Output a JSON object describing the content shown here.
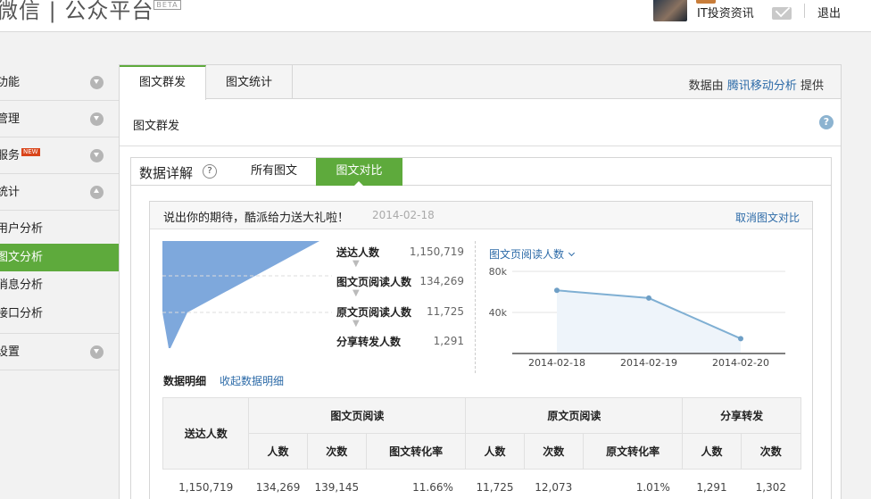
{
  "header": {
    "logo_text": "微信 | 公众平台",
    "logo_badge": "BETA",
    "user_name": "IT投资资讯",
    "logout": "退出",
    "icons": {
      "avatar": "avatar",
      "mail": "mail-icon"
    }
  },
  "sidebar": {
    "items": [
      {
        "label": "功能",
        "expanded": false
      },
      {
        "label": "管理",
        "expanded": false
      },
      {
        "label": "服务",
        "badge": "NEW",
        "expanded": false
      },
      {
        "label": "统计",
        "expanded": true
      }
    ],
    "stats_sub": [
      "用户分析",
      "图文分析",
      "消息分析",
      "接口分析"
    ],
    "active_sub": "图文分析",
    "settings": "设置"
  },
  "main": {
    "tabs": [
      "图文群发",
      "图文统计"
    ],
    "active_tab": "图文群发",
    "provider_prefix": "数据由",
    "provider_link": "腾讯移动分析",
    "provider_suffix": "提供",
    "section_title": "图文群发",
    "help": "?"
  },
  "detail": {
    "title": "数据详解",
    "help": "?",
    "tabs": [
      "所有图文",
      "图文对比"
    ],
    "active_tab": "图文对比"
  },
  "article": {
    "title": "说出你的期待，酷派给力送大礼啦！",
    "date": "2014-02-18",
    "cancel": "取消图文对比"
  },
  "funnel": [
    {
      "label": "送达人数",
      "value": "1,150,719"
    },
    {
      "label": "图文页阅读人数",
      "value": "134,269"
    },
    {
      "label": "原文页阅读人数",
      "value": "11,725"
    },
    {
      "label": "分享转发人数",
      "value": "1,291"
    }
  ],
  "chart_data": {
    "type": "area",
    "selector": "图文页阅读人数",
    "categories": [
      "2014-02-18",
      "2014-02-19",
      "2014-02-20"
    ],
    "series": [
      {
        "values": [
          61500,
          54000,
          14500
        ]
      }
    ],
    "ylim": [
      0,
      80000
    ],
    "y_ticks": [
      "80k",
      "40k"
    ],
    "grid": true,
    "colors": {
      "line": "#7fafd3",
      "fill": "#eef4fa",
      "point": "#6e9fc6"
    }
  },
  "breakdown": {
    "title": "数据明细",
    "toggle": "收起数据明细",
    "headers": {
      "delivered": "送达人数",
      "g1": "图文页阅读",
      "g2": "原文页阅读",
      "g3": "分享转发",
      "people": "人数",
      "times": "次数",
      "rate1": "图文转化率",
      "rate2": "原文转化率"
    },
    "rows": [
      [
        "1,150,719",
        "134,269",
        "139,145",
        "11.66%",
        "11,725",
        "12,073",
        "1.01%",
        "1,291",
        "1,302"
      ]
    ]
  },
  "colors": {
    "accent": "#5eaa3c",
    "link": "#2d6ba8",
    "funnel": "#7ea8dc"
  }
}
